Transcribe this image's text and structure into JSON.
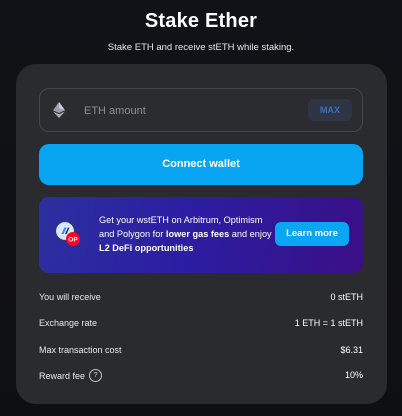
{
  "header": {
    "title": "Stake Ether",
    "subtitle": "Stake ETH and receive stETH while staking."
  },
  "form": {
    "eth_placeholder": "ETH amount",
    "max_label": "MAX",
    "connect_label": "Connect wallet"
  },
  "banner": {
    "text_1": "Get your wstETH on Arbitrum, Optimism and Polygon for ",
    "text_bold_1": "lower gas fees",
    "text_2": " and enjoy ",
    "text_bold_2": "L2 DeFi opportunities",
    "op_badge": "OP",
    "learn_more_label": "Learn more"
  },
  "stats": [
    {
      "label": "You will receive",
      "value": "0 stETH"
    },
    {
      "label": "Exchange rate",
      "value": "1 ETH = 1 stETH"
    },
    {
      "label": "Max transaction cost",
      "value": "$6.31"
    },
    {
      "label": "Reward fee",
      "value": "10%",
      "help": "?"
    }
  ],
  "colors": {
    "accent": "#09a5f3",
    "card": "#2a2b2f",
    "background": "#0f1014"
  },
  "icons": {
    "eth": "ethereum-icon",
    "arbitrum": "arbitrum-icon",
    "optimism": "optimism-icon",
    "help": "question-icon"
  }
}
